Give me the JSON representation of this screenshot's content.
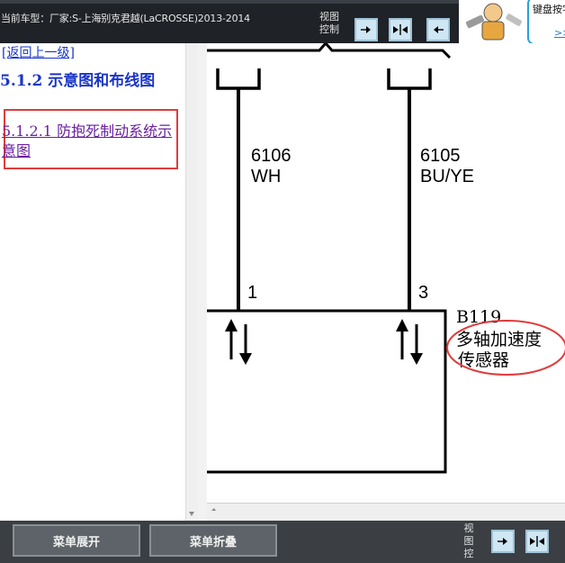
{
  "header": {
    "vehicle_label": "当前车型：厂家:S-上海别克君越(LaCROSSE)2013-2014",
    "view_control_label": "视图控制",
    "help_text": "键盘按字！",
    "help_more": ">>"
  },
  "sidebar": {
    "back_link": "[返回上一级]",
    "section": "5.1.2 示意图和布线图",
    "subsection": "5.1.2.1 防抱死制动系统示意图"
  },
  "diagram": {
    "wire_left": {
      "circuit": "6106",
      "color": "WH",
      "pin": "1"
    },
    "wire_right": {
      "circuit": "6105",
      "color": "BU/YE",
      "pin": "3"
    },
    "component": {
      "id": "B119",
      "name_line1": "多轴加速度",
      "name_line2": "传感器"
    }
  },
  "footer": {
    "expand_menu": "菜单展开",
    "collapse_menu": "菜单折叠",
    "view_control_label": "视图控"
  },
  "colors": {
    "accent_blue": "#1a35c8",
    "highlight_red": "#e03c3c",
    "visited_link": "#6a1fa0"
  }
}
